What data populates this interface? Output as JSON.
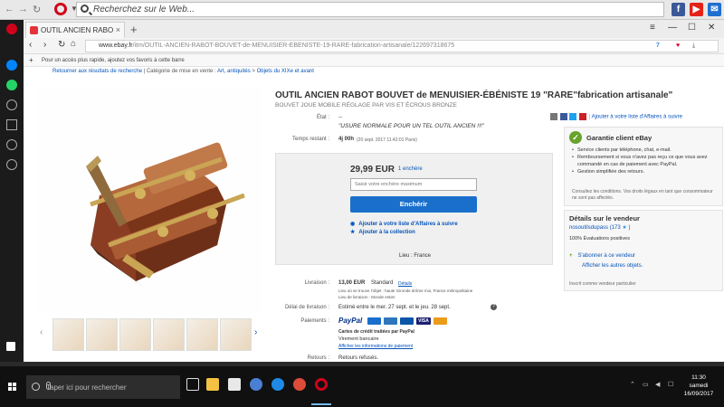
{
  "host": {
    "search_placeholder": "Recherchez sur le Web..."
  },
  "tab": {
    "title": "OUTIL ANCIEN RABOT BO",
    "close": "×",
    "new_tab": "+"
  },
  "address": {
    "url_host": "www.ebay.fr",
    "url_path": "/itm/OUTIL-ANCIEN-RABOT-BOUVET-de-MENUISIER-EBENISTE-19-RARE-fabrication-artisanale/122697318675",
    "badge_count": "7"
  },
  "bookmarks": {
    "prompt": "Pour un accès plus rapide, ajoutez vos favoris à cette barre"
  },
  "breadcrumb": {
    "back": "Retourner aux résultats de recherche",
    "sep1": "| Catégorie de mise en vente :",
    "cat1": "Art, antiquités",
    "cat2": "Objets du XIXe et avant"
  },
  "listing": {
    "title": "OUTIL ANCIEN RABOT BOUVET de MENUISIER-ÉBÉNISTE 19 \"RARE\"fabrication artisanale\"",
    "subtitle": "BOUVET JOUE MOBILE RÉGLAGE PAR VIS ET ÉCROUS BRONZE",
    "etat_label": "État :",
    "etat_value": "--",
    "etat_quote": "\"USURE NORMALE POUR UN TEL OUTIL ANCIEN !!!\"",
    "temps_label": "Temps restant :",
    "temps_value": "4j 00h",
    "temps_detail": "(20 sept. 2017   11:42:01 Paris)",
    "price": "29,99 EUR",
    "bids": "1 enchère",
    "bid_placeholder": "Saisir votre enchère maximum",
    "bid_button": "Enchérir",
    "watch": "Ajouter à votre liste d'Affaires à suivre",
    "collection": "Ajouter à la collection",
    "lieu": "Lieu : France"
  },
  "share": {
    "watch_link": "Ajouter à votre liste d'Affaires à suivre"
  },
  "guarantee": {
    "title": "Garantie client eBay",
    "items": [
      "Service clients par téléphone, chat, e-mail.",
      "Remboursement si vous n'avez pas reçu ce que vous avez commandé en cas de paiement avec PayPal.",
      "Gestion simplifiée des retours."
    ],
    "note": "Consultez les conditions. Vos droits légaux en tant que consommateur ne sont pas affectés."
  },
  "seller": {
    "heading": "Détails sur le vendeur",
    "name": "nosoutilsdupass",
    "score": "(173",
    "score_end": ")",
    "feedback": "100% Évaluations positives",
    "save": "S'abonner à ce vendeur",
    "other": "Afficher les autres objets.",
    "since": "Inscrit comme vendeur particulier"
  },
  "shipping": {
    "livraison_label": "Livraison :",
    "livraison_value": "13,00 EUR",
    "livraison_method": "Standard",
    "livraison_details": "Détails",
    "lieu_objet": "Lieu où se trouve l'objet : haute Gironde drôme moi, France métropolitaine",
    "lieu_livraison": "Lieu de livraison : Monde entier",
    "delai_label": "Délai de livraison :",
    "delai_value": "Estimé entre le mer. 27 sept. et le jeu. 28 sept.",
    "paiements_label": "Paiements :",
    "paypal": "PayPal",
    "visa": "VISA",
    "cartes": "Cartes de crédit traitées par PayPal",
    "virement": "Virement bancaire",
    "infos": "Afficher les informations de paiement",
    "retours_label": "Retours :",
    "retours_value": "Retours refusés."
  },
  "taskbar": {
    "search_placeholder": "Taper ici pour rechercher",
    "time": "11:30",
    "day": "samedi",
    "date": "16/09/2017"
  },
  "colors": {
    "ebay_blue": "#0654ba",
    "bid_button": "#1a6fcc",
    "opera_red": "#d0021b",
    "guarantee_green": "#67a32a"
  }
}
